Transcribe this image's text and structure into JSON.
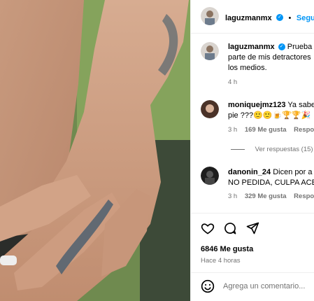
{
  "post": {
    "author": "laguzmanmx",
    "follow_label": "Seguir",
    "separator": "•",
    "caption_lines": [
      "Prueba",
      "parte de mis detractores",
      "los medios."
    ],
    "caption_time": "4 h",
    "likes": "6846 Me gusta",
    "posted_ago": "Hace 4 horas",
    "comment_placeholder": "Agrega un comentario..."
  },
  "comments": [
    {
      "user": "moniquejmz123",
      "text_lines": [
        "Ya sabe",
        "pie ???🙂🙂🍺🏆🏆🎉"
      ],
      "time": "3 h",
      "likes": "169 Me gusta",
      "reply": "Respon",
      "view_replies": "Ver respuestas (15)"
    },
    {
      "user": "danonin_24",
      "text_lines": [
        "Dicen por a",
        "NO PEDIDA, CULPA ACEP"
      ],
      "time": "3 h",
      "likes": "329 Me gusta",
      "reply": "Respo"
    }
  ],
  "icons": {
    "verified": "verified-badge-icon",
    "like": "heart-icon",
    "comment": "comment-icon",
    "share": "share-icon",
    "emoji": "emoji-icon"
  },
  "colors": {
    "accent": "#0095f6",
    "muted": "#737373"
  }
}
